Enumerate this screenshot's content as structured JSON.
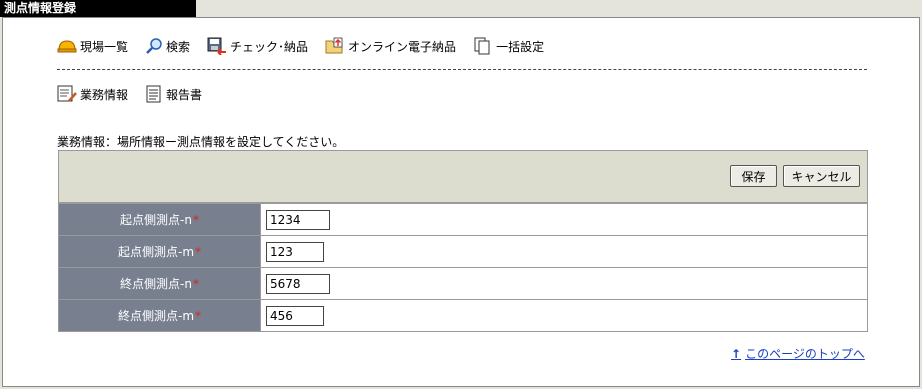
{
  "window": {
    "title": "測点情報登録"
  },
  "nav": {
    "items": [
      {
        "label": "現場一覧",
        "icon": "hardhat-icon"
      },
      {
        "label": "検索",
        "icon": "magnifier-icon"
      },
      {
        "label": "チェック･納品",
        "icon": "disk-arrow-icon"
      },
      {
        "label": "オンライン電子納品",
        "icon": "folder-upload-icon"
      },
      {
        "label": "一括設定",
        "icon": "documents-icon"
      }
    ],
    "secondary": [
      {
        "label": "業務情報",
        "icon": "edit-document-icon"
      },
      {
        "label": "報告書",
        "icon": "report-icon"
      }
    ]
  },
  "instruction": "業務情報：場所情報ー測点情報を設定してください。",
  "buttons": {
    "save": "保存",
    "cancel": "キャンセル"
  },
  "required_mark": "*",
  "fields": [
    {
      "label": "起点側測点-n",
      "value": "1234"
    },
    {
      "label": "起点側測点-m",
      "value": "123"
    },
    {
      "label": "終点側測点-n",
      "value": "5678"
    },
    {
      "label": "終点側測点-m",
      "value": "456"
    }
  ],
  "footer": {
    "top_link_arrow": "↑",
    "top_link": "このページのトップへ"
  },
  "colors": {
    "label_bg": "#788090",
    "button_bar_bg": "#dcdccf",
    "link": "#1a3fc0",
    "required": "#e02020"
  }
}
